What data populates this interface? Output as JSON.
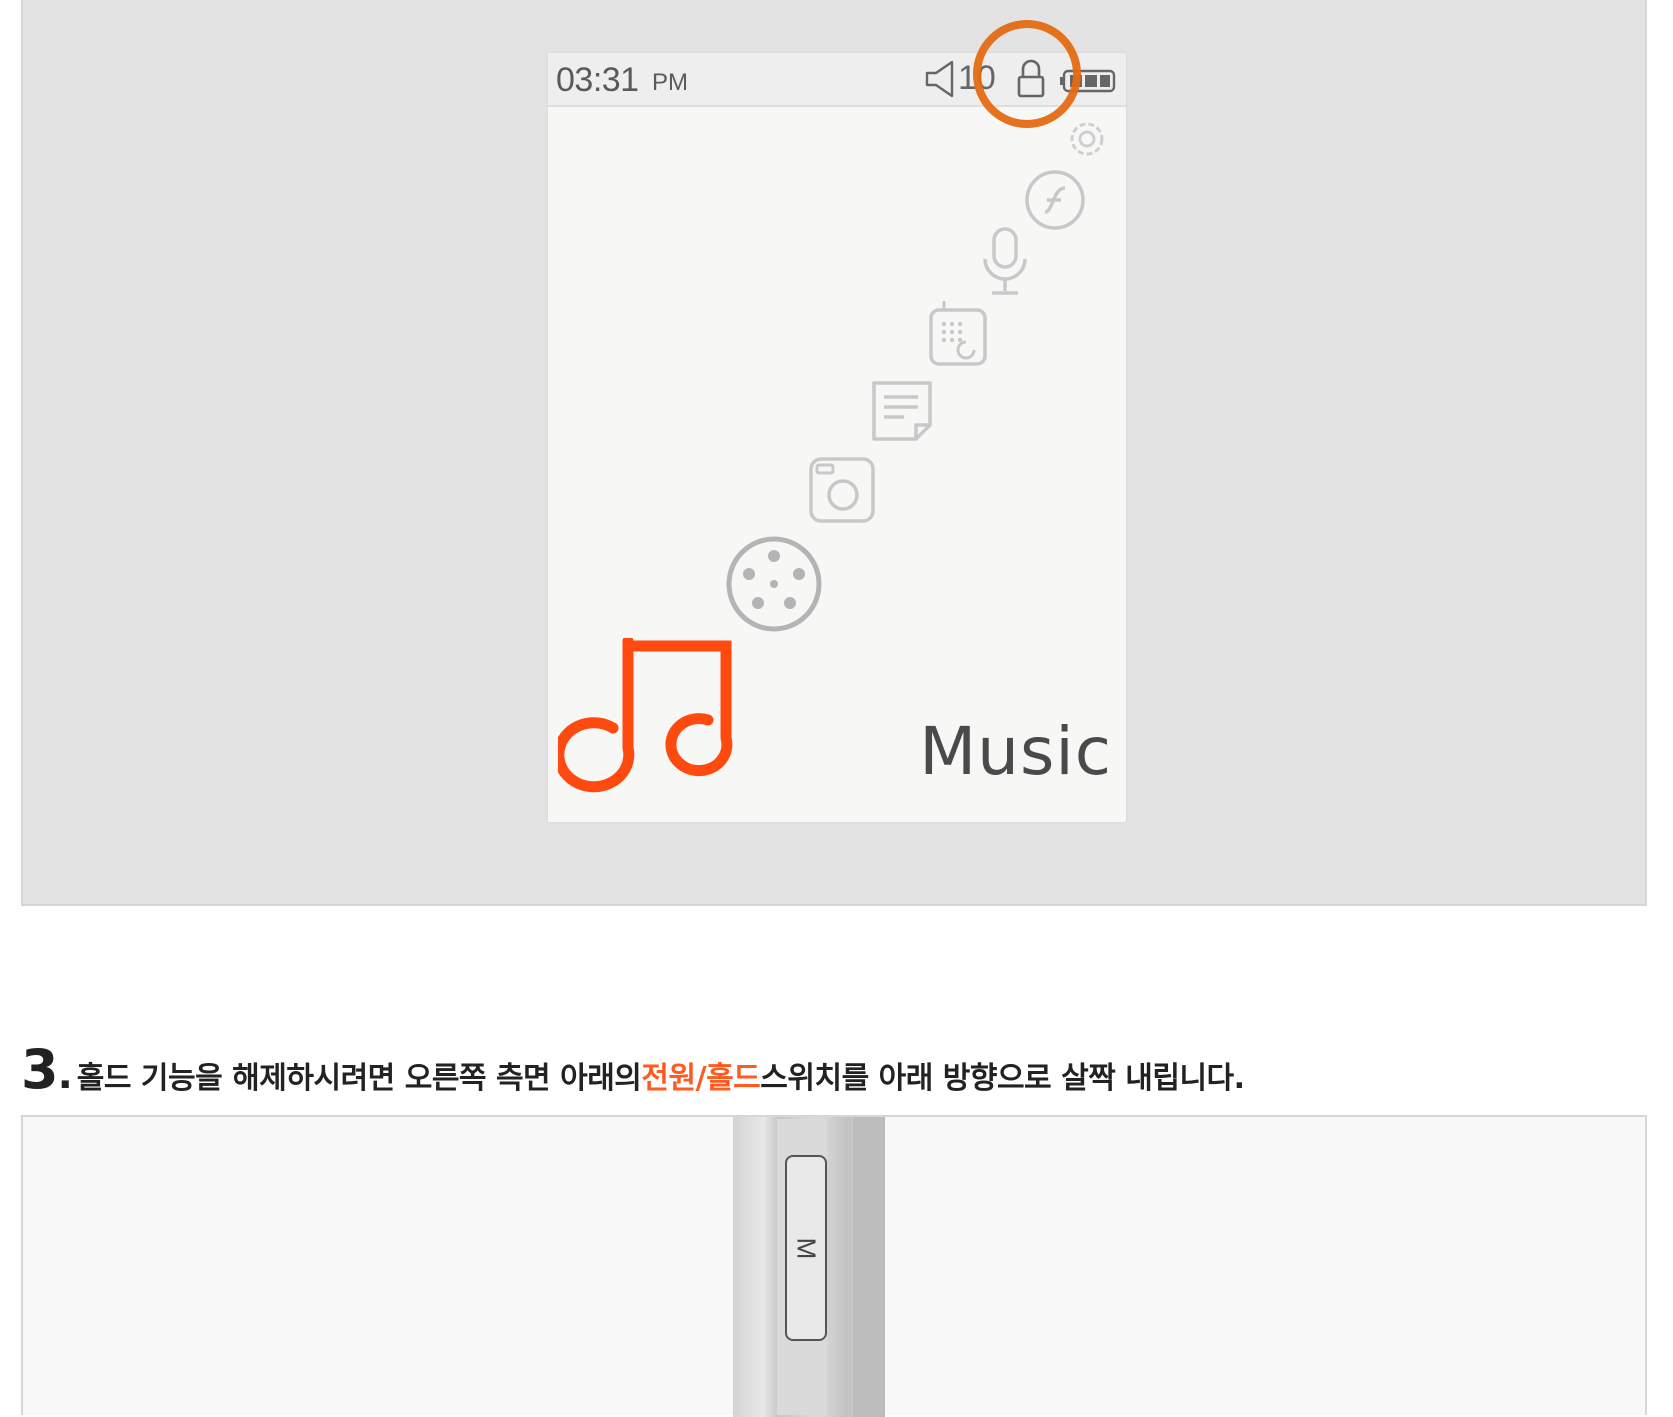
{
  "phone": {
    "status_bar": {
      "time": "03:31",
      "ampm": "PM",
      "volume_icon": "speaker-icon",
      "volume_level": "10",
      "lock_icon": "lock-icon",
      "battery_icon": "battery-icon"
    },
    "menu_icons": [
      "gear-icon",
      "flash-icon",
      "microphone-icon",
      "dialer-icon",
      "notes-icon",
      "camera-icon",
      "film-reel-icon",
      "music-note-icon"
    ],
    "selected_label": "Music",
    "accent_color": "#ff4a0f",
    "highlight_color": "#e36a13"
  },
  "step": {
    "number": "3",
    "dot": ".",
    "text_before": "홀드 기능을 해제하시려면 오른쪽 측면 아래의 ",
    "text_accent": "전원/홀드",
    "text_after": " 스위치를 아래 방향으로 살짝 내립니다.",
    "accent_color": "#ff5a1f"
  },
  "device": {
    "button_letter": "M"
  }
}
